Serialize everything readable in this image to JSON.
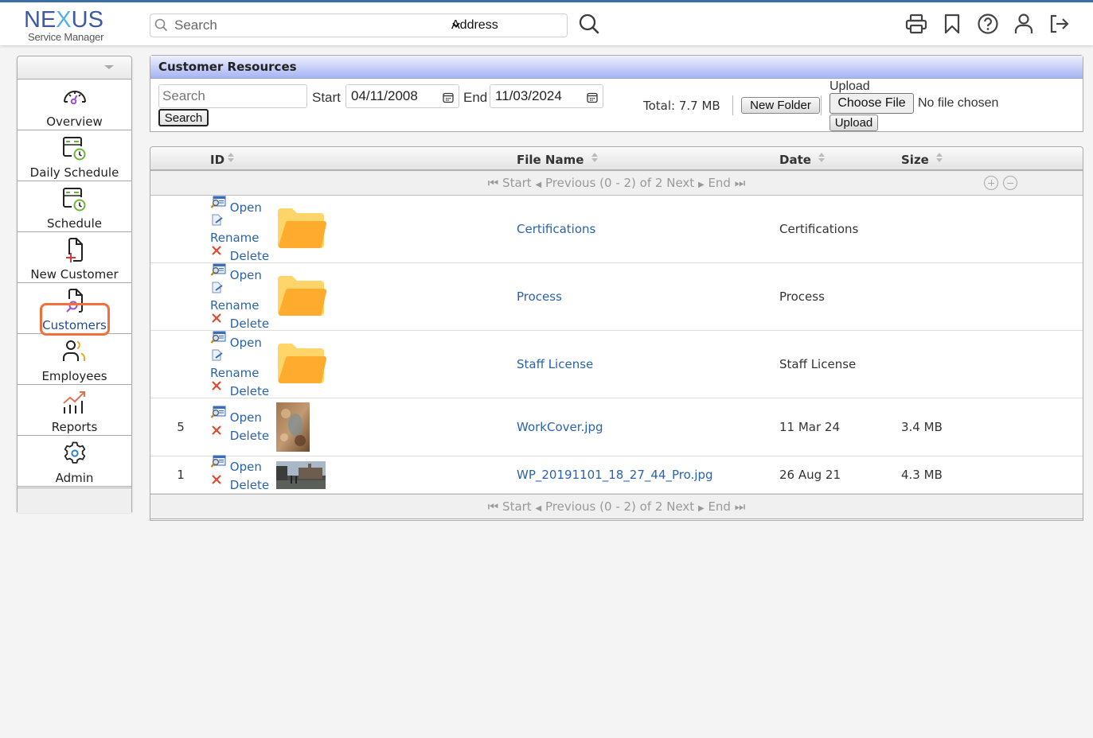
{
  "app": {
    "logo_main_left": "NE",
    "logo_main_x": "X",
    "logo_main_right": "US",
    "logo_sub": "Service Manager"
  },
  "topbar": {
    "search_placeholder": "Search",
    "search_value": "",
    "search_field_select": "Address",
    "icons": [
      "printer-icon",
      "bookmark-icon",
      "help-icon",
      "user-icon",
      "logout-icon"
    ]
  },
  "sidebar": {
    "items": [
      {
        "label": "Overview",
        "icon": "speedometer-icon"
      },
      {
        "label": "Daily Schedule",
        "icon": "calendar-clock-icon"
      },
      {
        "label": "Schedule",
        "icon": "calendar-clock-icon"
      },
      {
        "label": "New Customer",
        "icon": "file-plus-icon"
      },
      {
        "label": "Customers",
        "icon": "file-search-icon",
        "active": true
      },
      {
        "label": "Employees",
        "icon": "people-icon"
      },
      {
        "label": "Reports",
        "icon": "chart-trend-icon"
      },
      {
        "label": "Admin",
        "icon": "gear-icon"
      }
    ]
  },
  "panel": {
    "title": "Customer Resources",
    "search_placeholder": "Search",
    "search_value": "",
    "search_button": "Search",
    "start_label": "Start",
    "start_date": "04/11/2008",
    "end_label": "End",
    "end_date": "11/03/2024",
    "total_label": "Total: 7.7 MB",
    "new_folder_button": "New Folder",
    "upload_label": "Upload",
    "choose_file_button": "Choose File",
    "no_file_text": "No file chosen",
    "upload_button": "Upload"
  },
  "grid": {
    "columns": {
      "id": "ID",
      "file_name": "File Name",
      "date": "Date",
      "size": "Size"
    },
    "pager": {
      "start": "Start",
      "previous": "Previous",
      "range": "(0 - 2) of 2",
      "next": "Next",
      "end": "End"
    },
    "actions": {
      "open": "Open",
      "rename": "Rename",
      "delete": "Delete"
    },
    "rows": [
      {
        "id": "",
        "type": "folder",
        "name": "Certifications",
        "date": "Certifications",
        "size": ""
      },
      {
        "id": "",
        "type": "folder",
        "name": "Process",
        "date": "Process",
        "size": ""
      },
      {
        "id": "",
        "type": "folder",
        "name": "Staff License",
        "date": "Staff License",
        "size": ""
      },
      {
        "id": "5",
        "type": "image",
        "name": "WorkCover.jpg",
        "date": "11 Mar 24",
        "size": "3.4 MB"
      },
      {
        "id": "1",
        "type": "image",
        "name": "WP_20191101_18_27_44_Pro.jpg",
        "date": "26 Aug 21",
        "size": "4.3 MB"
      }
    ]
  }
}
